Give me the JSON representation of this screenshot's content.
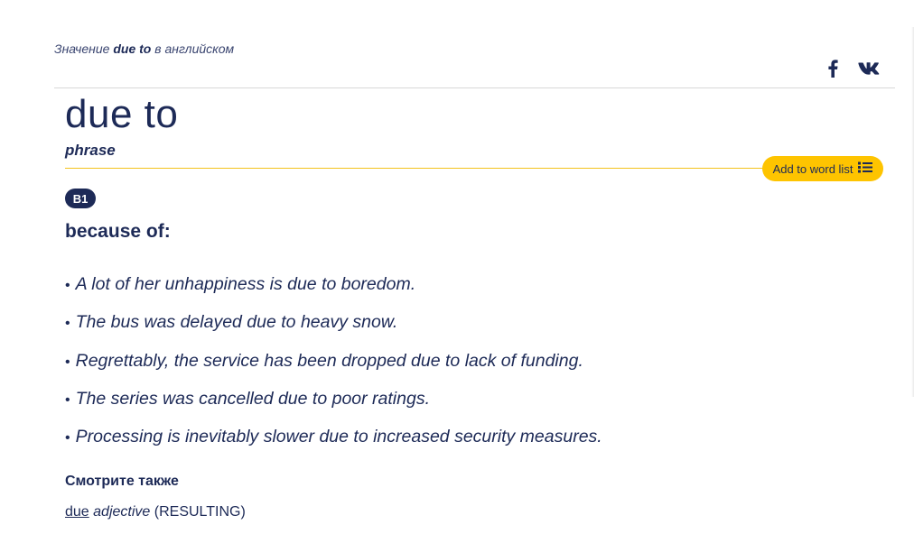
{
  "breadcrumb": {
    "prefix": "Значение",
    "term": "due to",
    "suffix": "в английском"
  },
  "social": {
    "facebook_icon": "facebook-icon",
    "vk_icon": "vk-icon"
  },
  "entry": {
    "headword": "due to",
    "part_of_speech": "phrase",
    "add_to_word_list_label": "Add to word list",
    "level": "B1",
    "definition": "because of:",
    "examples": [
      "A lot of her unhappiness is due to boredom.",
      "The bus was delayed due to heavy snow.",
      "Regrettably, the service has been dropped due to lack of funding.",
      "The series was cancelled due to poor ratings.",
      "Processing is inevitably slower due to increased security measures."
    ],
    "bullet": "•"
  },
  "see_also": {
    "title": "Смотрите также",
    "link": "due",
    "pos": "adjective",
    "guide": "(RESULTING)"
  },
  "colors": {
    "navy": "#1d2a57",
    "gold": "#fec400",
    "rule_gold": "#f3c21c"
  }
}
